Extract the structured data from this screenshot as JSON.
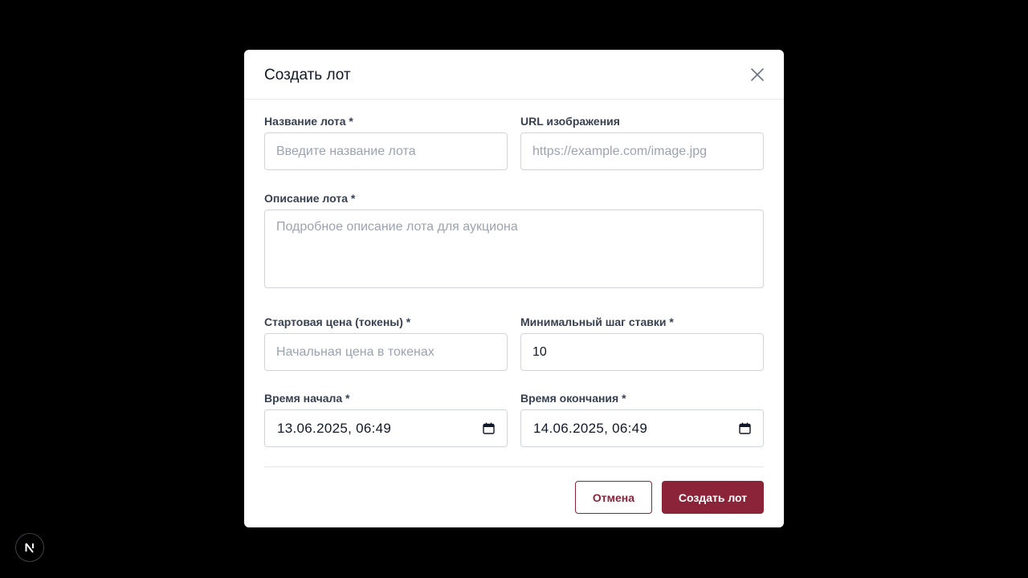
{
  "modal": {
    "title": "Создать лот"
  },
  "form": {
    "name": {
      "label": "Название лота *",
      "placeholder": "Введите название лота",
      "value": ""
    },
    "image_url": {
      "label": "URL изображения",
      "placeholder": "https://example.com/image.jpg",
      "value": ""
    },
    "description": {
      "label": "Описание лота *",
      "placeholder": "Подробное описание лота для аукциона",
      "value": ""
    },
    "start_price": {
      "label": "Стартовая цена (токены) *",
      "placeholder": "Начальная цена в токенах",
      "value": ""
    },
    "min_step": {
      "label": "Минимальный шаг ставки *",
      "placeholder": "",
      "value": "10"
    },
    "start_time": {
      "label": "Время начала *",
      "value": "13.06.2025, 06:49"
    },
    "end_time": {
      "label": "Время окончания *",
      "value": "14.06.2025, 06:49"
    }
  },
  "actions": {
    "cancel_label": "Отмена",
    "submit_label": "Создать лот"
  },
  "icons": {
    "close": "close-icon",
    "calendar": "calendar-icon",
    "framework_badge": "next-logo-icon"
  },
  "colors": {
    "accent": "#8b2339",
    "backdrop": "#000000",
    "modal_bg": "#ffffff",
    "border": "#d1d5db",
    "placeholder": "#9ca3af"
  }
}
